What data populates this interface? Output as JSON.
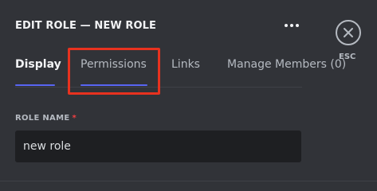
{
  "header": {
    "title": "EDIT ROLE — NEW ROLE",
    "more_icon": "ellipsis-icon",
    "close_icon": "close-icon",
    "close_hint": "ESC"
  },
  "tabs": [
    {
      "label": "Display",
      "active": true
    },
    {
      "label": "Permissions",
      "active": false,
      "highlighted": true
    },
    {
      "label": "Links",
      "active": false
    },
    {
      "label": "Manage Members (0)",
      "active": false
    }
  ],
  "form": {
    "role_name_label": "ROLE NAME",
    "required_marker": "*",
    "role_name_value": "new role"
  },
  "colors": {
    "background": "#313338",
    "accent": "#5865f2",
    "highlight": "#e8321f",
    "required": "#f23f42",
    "input_bg": "#1e1f22"
  }
}
